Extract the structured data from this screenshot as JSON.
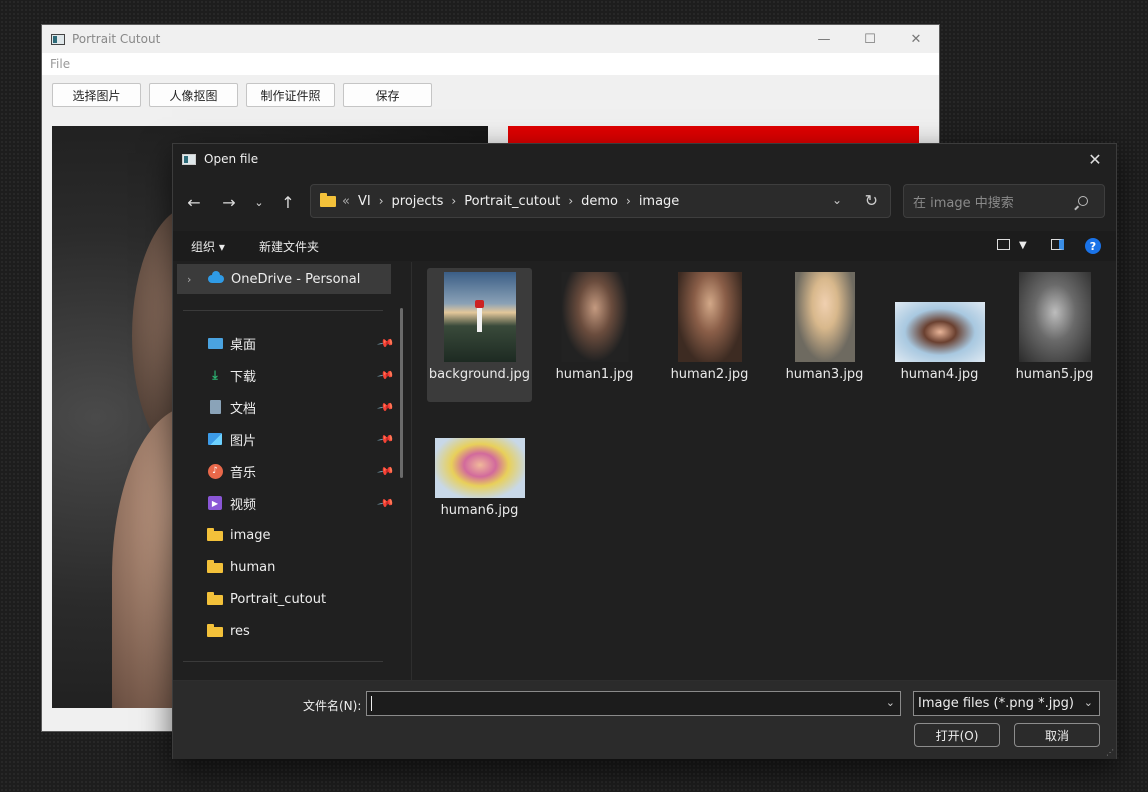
{
  "app": {
    "title": "Portrait Cutout",
    "menu": [
      "File"
    ],
    "buttons": [
      "选择图片",
      "人像抠图",
      "制作证件照",
      "保存"
    ],
    "preview_right_color": "#e00000"
  },
  "dialog": {
    "title": "Open file",
    "breadcrumbs": [
      "VI",
      "projects",
      "Portrait_cutout",
      "demo",
      "image"
    ],
    "crumb_more": "«",
    "search_placeholder": "在 image 中搜索",
    "commands": {
      "organize": "组织 ▾",
      "new_folder": "新建文件夹",
      "help": "?"
    },
    "sidebar": {
      "onedrive": "OneDrive - Personal",
      "quick_access": [
        {
          "label": "桌面",
          "icon": "desktop-icon",
          "pinned": true
        },
        {
          "label": "下载",
          "icon": "download-icon",
          "pinned": true
        },
        {
          "label": "文档",
          "icon": "document-icon",
          "pinned": true
        },
        {
          "label": "图片",
          "icon": "pictures-icon",
          "pinned": true
        },
        {
          "label": "音乐",
          "icon": "music-icon",
          "pinned": true
        },
        {
          "label": "视频",
          "icon": "video-icon",
          "pinned": true
        }
      ],
      "folders": [
        "image",
        "human",
        "Portrait_cutout",
        "res"
      ]
    },
    "files": [
      {
        "name": "background.jpg",
        "selected": true
      },
      {
        "name": "human1.jpg",
        "selected": false
      },
      {
        "name": "human2.jpg",
        "selected": false
      },
      {
        "name": "human3.jpg",
        "selected": false
      },
      {
        "name": "human4.jpg",
        "selected": false
      },
      {
        "name": "human5.jpg",
        "selected": false
      },
      {
        "name": "human6.jpg",
        "selected": false
      }
    ],
    "filename_label": "文件名(N):",
    "filename_value": "",
    "filter": "Image files (*.png *.jpg)",
    "open_button": "打开(O)",
    "cancel_button": "取消"
  }
}
